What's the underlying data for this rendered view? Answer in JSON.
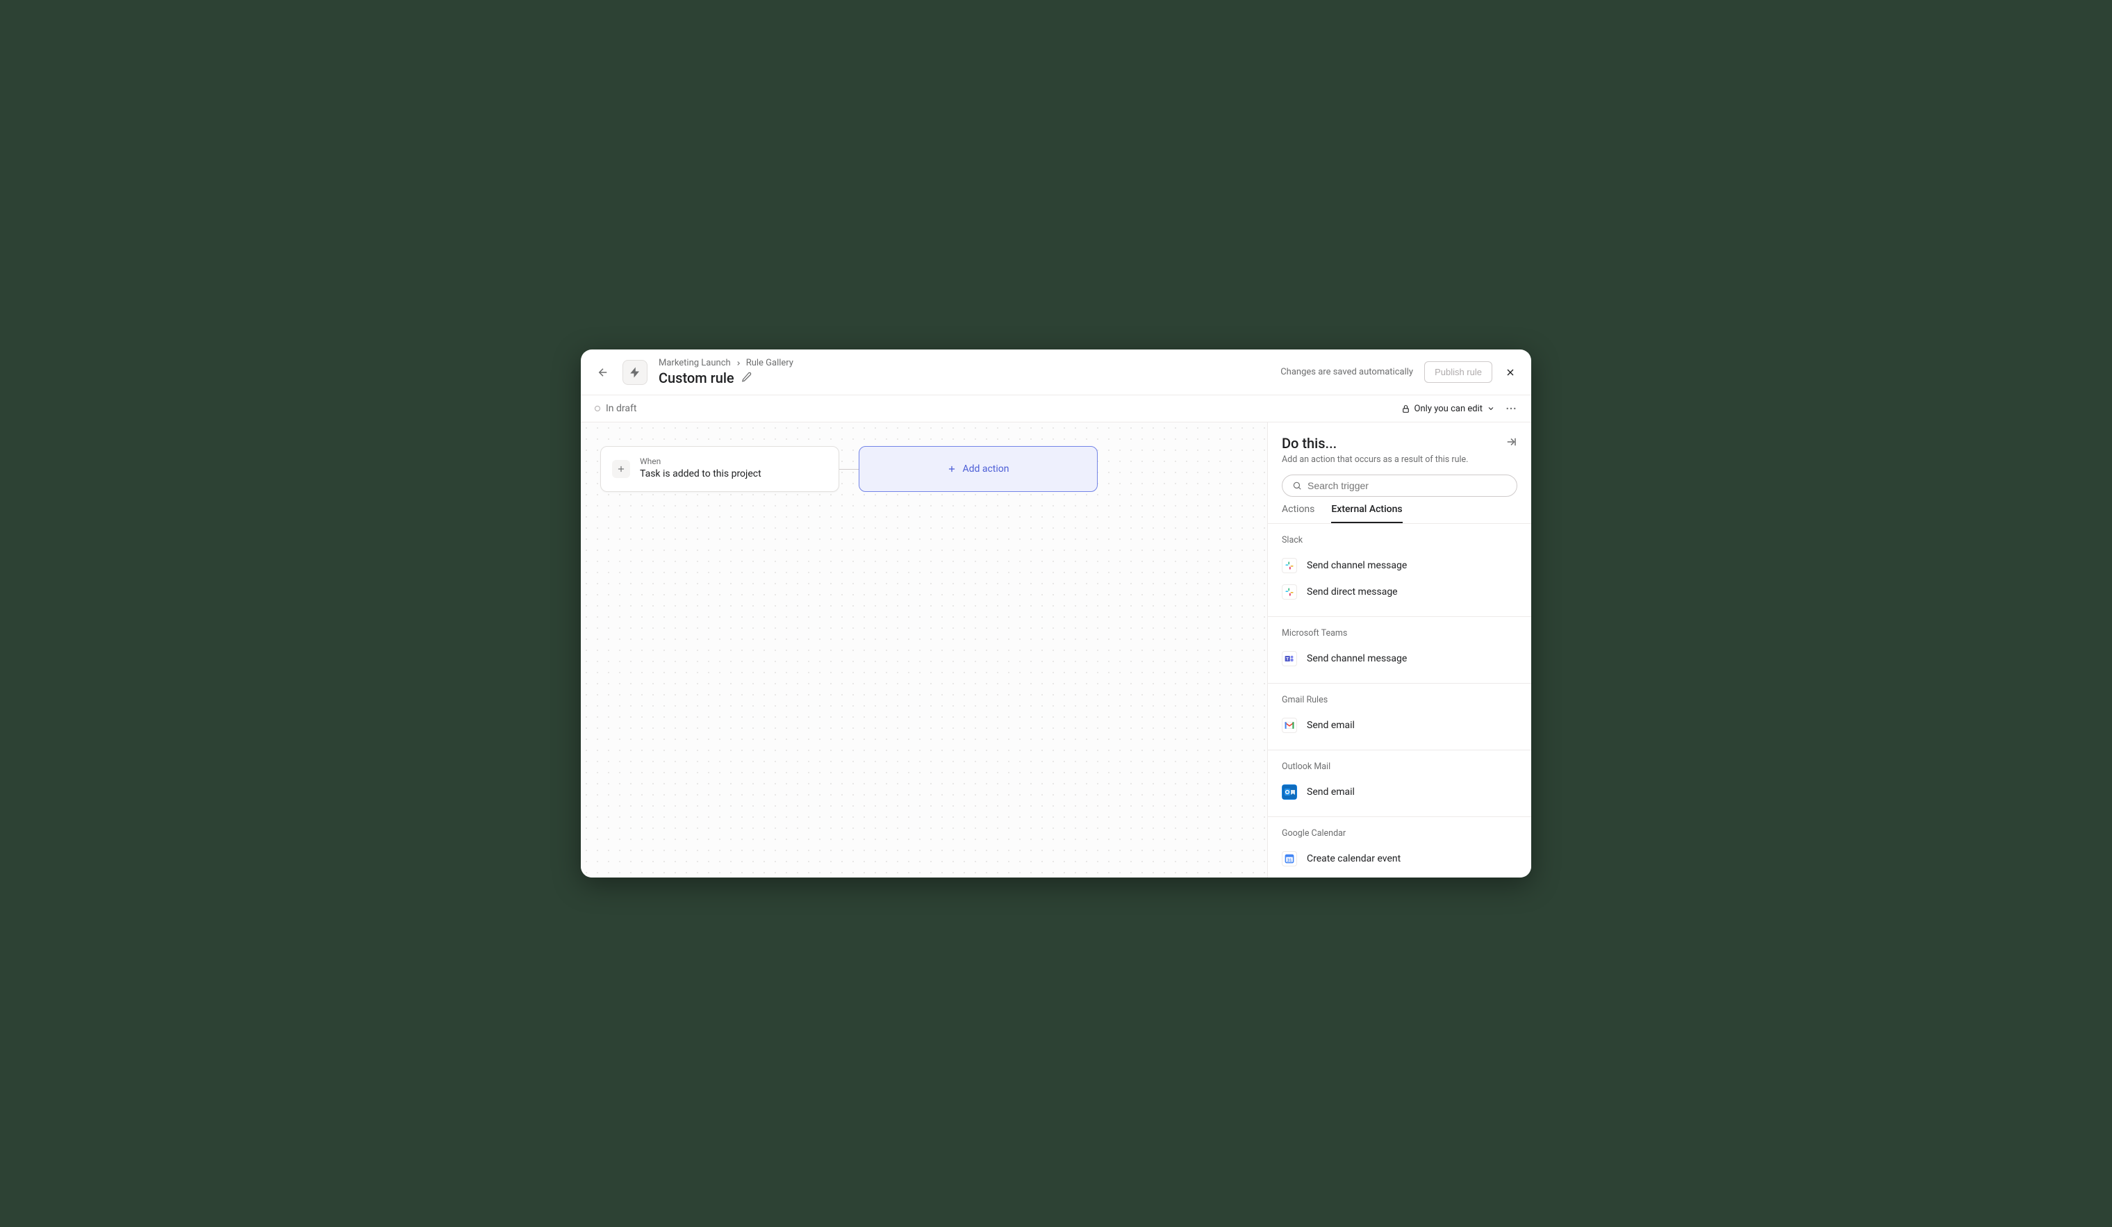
{
  "header": {
    "breadcrumb": [
      "Marketing Launch",
      "Rule Gallery"
    ],
    "title": "Custom rule",
    "save_status": "Changes are saved automatically",
    "publish_label": "Publish rule"
  },
  "subheader": {
    "status_label": "In draft",
    "permission_label": "Only you can edit"
  },
  "canvas": {
    "trigger": {
      "label": "When",
      "description": "Task is added to this project"
    },
    "add_action_label": "Add action"
  },
  "panel": {
    "title": "Do this...",
    "subtitle": "Add an action that occurs as a result of this rule.",
    "search_placeholder": "Search trigger",
    "tabs": {
      "actions": "Actions",
      "external": "External Actions"
    },
    "groups": [
      {
        "name": "Slack",
        "actions": [
          {
            "label": "Send channel message",
            "icon": "slack"
          },
          {
            "label": "Send direct message",
            "icon": "slack"
          }
        ]
      },
      {
        "name": "Microsoft Teams",
        "actions": [
          {
            "label": "Send channel message",
            "icon": "teams"
          }
        ]
      },
      {
        "name": "Gmail Rules",
        "actions": [
          {
            "label": "Send email",
            "icon": "gmail"
          }
        ]
      },
      {
        "name": "Outlook Mail",
        "actions": [
          {
            "label": "Send email",
            "icon": "outlook"
          }
        ]
      },
      {
        "name": "Google Calendar",
        "actions": [
          {
            "label": "Create calendar event",
            "icon": "gcal"
          }
        ]
      }
    ]
  }
}
